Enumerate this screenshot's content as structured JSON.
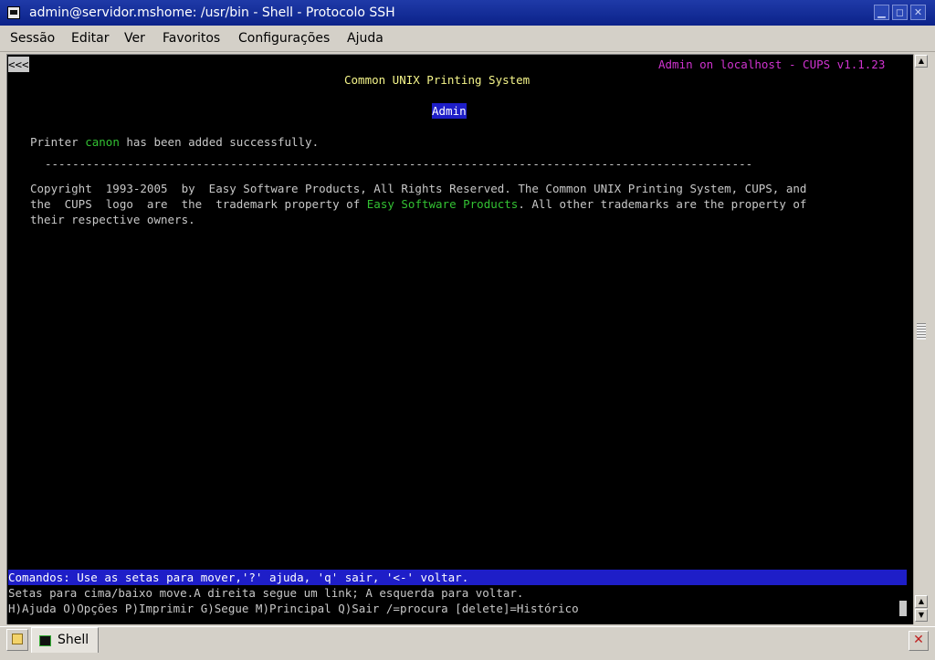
{
  "window": {
    "title": "admin@servidor.mshome: /usr/bin - Shell - Protocolo SSH",
    "minimize": "▁",
    "maximize": "◻",
    "close": "✕"
  },
  "menu": [
    "Sessão",
    "Editar",
    "Ver",
    "Favoritos",
    "Configurações",
    "Ajuda"
  ],
  "terminal": {
    "back_link": "<<<",
    "header_right": "Admin on localhost - CUPS v1.1.23",
    "heading": "Common UNIX Printing System",
    "admin_link": "Admin",
    "msg_prefix": "Printer ",
    "printer_name": "canon",
    "msg_suffix": " has been added successfully.",
    "separator": "-------------------------------------------------------------------------------------------------------",
    "copyright_1": "Copyright  1993-2005  by  Easy Software Products, All Rights Reserved. The Common UNIX Printing System, CUPS, and",
    "copyright_2a": "the  CUPS  logo  are  the  trademark property of ",
    "copyright_2_link": "Easy Software Products",
    "copyright_2b": ". All other trademarks are the property of",
    "copyright_3": "their respective owners.",
    "status_cmd": "Comandos: Use as setas para mover,'?' ajuda, 'q' sair, '<-' voltar.",
    "status_help": "Setas para cima/baixo move.A direita segue um link; A esquerda para voltar.",
    "status_keys": "H)Ajuda O)Opções P)Imprimir G)Segue M)Principal Q)Sair /=procura [delete]=Histórico"
  },
  "tabs": [
    {
      "label": "Shell",
      "icon": "terminal-icon"
    }
  ],
  "colors": {
    "title_bar": "#0b2289",
    "terminal_bg": "#000000",
    "link_green": "#33c233",
    "header_magenta": "#d033d0",
    "heading_yellow": "#f5f58a",
    "highlight_blue": "#1e1ec8"
  }
}
